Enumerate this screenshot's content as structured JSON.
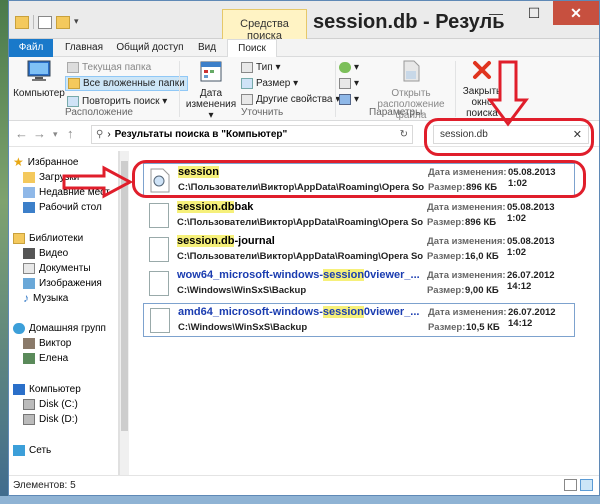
{
  "window": {
    "title": "session.db - Резуль",
    "contextual_tab": "Средства поиска",
    "minimize": "—",
    "maximize": "☐",
    "close": "✕"
  },
  "tabs": [
    "Файл",
    "Главная",
    "Общий доступ",
    "Вид",
    "Поиск"
  ],
  "ribbon": {
    "computer": "Компьютер",
    "current_folder": "Текущая папка",
    "all_subfolders": "Все вложенные папки",
    "search_again": "Повторить поиск ▾",
    "group_location": "Расположение",
    "date_modified": "Дата изменения ▾",
    "type": "Тип ▾",
    "size": "Размер ▾",
    "other_properties": "Другие свойства ▾",
    "group_refine": "Уточнить",
    "recent_searches": "▾",
    "advanced": "▾",
    "save": "▾",
    "open_location": "Открыть расположение файла",
    "group_options": "Параметры",
    "close_search": "Закрыть окно поиска"
  },
  "address": {
    "back": "←",
    "forward": "→",
    "up": "↑",
    "path": "Результаты поиска в \"Компьютер\"",
    "refresh": "↻",
    "search_value": "session.db",
    "clear": "✕"
  },
  "navpane": {
    "favorites": "Избранное",
    "downloads": "Загрузки",
    "recent": "Недавние мест",
    "desktop": "Рабочий стол",
    "libraries": "Библиотеки",
    "video": "Видео",
    "documents": "Документы",
    "images": "Изображения",
    "music": "Музыка",
    "homegroup": "Домашняя групп",
    "user1": "Виктор",
    "user2": "Елена",
    "computer": "Компьютер",
    "disk_c": "Disk (C:)",
    "disk_d": "Disk (D:)",
    "network": "Сеть"
  },
  "meta_labels": {
    "date": "Дата изменения:",
    "size": "Размер:"
  },
  "results": [
    {
      "name_hl": "session",
      "name_rest": "",
      "path": "C:\\Пользователи\\Виктор\\AppData\\Roaming\\Opera Sof...",
      "date": "05.08.2013 1:02",
      "size": "896 КБ"
    },
    {
      "name_hl": "session.db",
      "name_rest": "bak",
      "path": "C:\\Пользователи\\Виктор\\AppData\\Roaming\\Opera Sof...",
      "date": "05.08.2013 1:02",
      "size": "896 КБ"
    },
    {
      "name_hl": "session.db",
      "name_rest": "-journal",
      "path": "C:\\Пользователи\\Виктор\\AppData\\Roaming\\Opera Sof...",
      "date": "05.08.2013 1:02",
      "size": "16,0 КБ"
    },
    {
      "name_pre": "wow64_microsoft-windows-",
      "name_hl": "session",
      "name_rest": "0viewer_...",
      "path": "C:\\Windows\\WinSxS\\Backup",
      "date": "26.07.2012 14:12",
      "size": "9,00 КБ"
    },
    {
      "name_pre": "amd64_microsoft-windows-",
      "name_hl": "session",
      "name_rest": "0viewer_...",
      "path": "C:\\Windows\\WinSxS\\Backup",
      "date": "26.07.2012 14:12",
      "size": "10,5 КБ"
    }
  ],
  "status": {
    "items": "Элементов: 5"
  },
  "colors": {
    "accent": "#1979ca",
    "annotation_red": "#e01e2b",
    "highlight": "#f6f07a",
    "context_tab": "#fff3c4"
  }
}
